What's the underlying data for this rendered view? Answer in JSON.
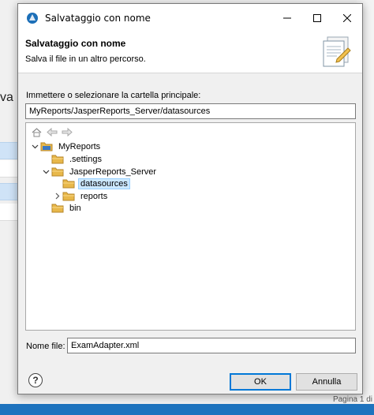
{
  "background": {
    "fragment_text": "va",
    "page_indicator": "Pagina 1 di"
  },
  "dialog": {
    "window_title": "Salvataggio con nome",
    "banner": {
      "title": "Salvataggio con nome",
      "subtitle": "Salva il file in un altro percorso."
    },
    "parent_folder_label": "Immettere o selezionare la cartella principale:",
    "parent_folder_value": "MyReports/JasperReports_Server/datasources",
    "tree": [
      {
        "label": "MyReports",
        "expanded": true
      },
      {
        "label": ".settings"
      },
      {
        "label": "JasperReports_Server",
        "expanded": true
      },
      {
        "label": "datasources",
        "selected": true
      },
      {
        "label": "reports",
        "expanded": false
      },
      {
        "label": "bin"
      }
    ],
    "file_name_label": "Nome file:",
    "file_name_value": "ExamAdapter.xml",
    "help_glyph": "?",
    "ok_label": "OK",
    "cancel_label": "Annulla"
  },
  "colors": {
    "accent": "#0078d7",
    "selection": "#cce8ff",
    "folder": "#e8b84a",
    "taskbar": "#1e73be"
  },
  "icons": [
    "app-icon",
    "minimize-icon",
    "maximize-icon",
    "close-icon",
    "save-as-banner-icon",
    "home-icon",
    "back-arrow-icon",
    "forward-arrow-icon",
    "folder-icon",
    "project-folder-icon",
    "help-icon"
  ]
}
